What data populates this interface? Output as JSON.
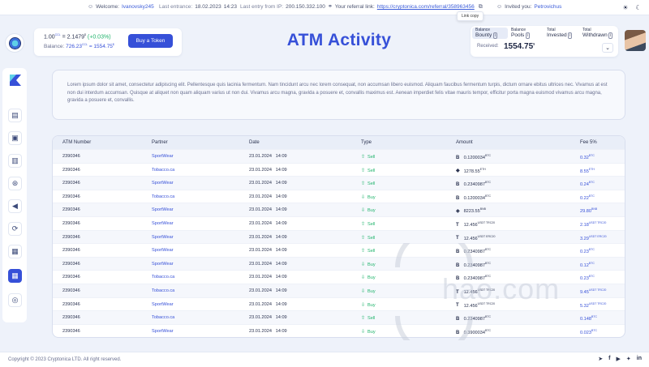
{
  "topbar": {
    "welcome_label": "Welcome:",
    "username": "Ivanovsky245",
    "last_entrance_label": "Last entrance:",
    "last_entrance_date": "18.02.2023",
    "last_entrance_time": "14:23",
    "last_ip_label": "Last entry from IP:",
    "last_ip": "200.150.332.100",
    "referral_label": "Your referral link:",
    "referral_link": "https://cryptonica.com/referral/358963456",
    "copy_tooltip": "Link copy",
    "invited_label": "Invited you:",
    "invited_by": "Petrovichus"
  },
  "rate": {
    "line1_prefix": "1.00",
    "line1_unit": "CCL",
    "line1_eq": " = 2.1479",
    "line1_usd": "$",
    "line1_change": " (+0.03%)",
    "balance_label": "Balance:",
    "balance_ccl": "726.23",
    "balance_unit": "CCL",
    "balance_usd": " = 1554.75",
    "balance_usd_sign": "$",
    "buy_button": "Buy a Token"
  },
  "page_title": "ATM Activity",
  "balance_panel": {
    "tabs": [
      {
        "top": "Balance",
        "bottom": "Bounty"
      },
      {
        "top": "Balance",
        "bottom": "Pools"
      },
      {
        "top": "Total",
        "bottom": "Invested"
      },
      {
        "top": "Total",
        "bottom": "Withdrawn"
      }
    ],
    "received_label": "Received:",
    "received_value": "1554.75",
    "received_sign": "$"
  },
  "description": "Lorem ipsum dolor sit amet, consectetur adipiscing elit. Pellentesque quis lacinia fermentum. Nam tincidunt arcu nec lorem consequat, non accumsan libero euismod. Aliquam faucibus fermentum turpis, dictum ornare ebitus ultrices nec. Vivamus at est non dui interdum accumsan. Quisque at aliquet non quam aliquam varius ut non dui. Vivamus arcu magna, gravida a posuere et, convallis maximus est. Aenean imperdiet felis vitae mauris tempor, efficitur porta magna euismod vivamus arcu magna, gravida a posuere et, convallis.",
  "table": {
    "headers": [
      "ATM Number",
      "Partner",
      "Date",
      "Type",
      "Amount",
      "Fee 5%"
    ],
    "rows": [
      {
        "atm": "2390346",
        "partner": "SportWear",
        "date": "23.01.2024",
        "time": "14:09",
        "type": "Sell",
        "dir": "up",
        "sym": "B",
        "amount": "0.1200034",
        "unit": "BTC",
        "fee": "0.32",
        "fee_unit": "BTC"
      },
      {
        "atm": "2390346",
        "partner": "Tobacco.ca",
        "date": "23.01.2024",
        "time": "14:09",
        "type": "Sell",
        "dir": "up",
        "sym": "◆",
        "amount": "1278.55",
        "unit": "ETH",
        "fee": "8.55",
        "fee_unit": "ETH"
      },
      {
        "atm": "2390346",
        "partner": "SportWear",
        "date": "23.01.2024",
        "time": "14:09",
        "type": "Sell",
        "dir": "up",
        "sym": "B",
        "amount": "0.2340987",
        "unit": "BTC",
        "fee": "0.24",
        "fee_unit": "BTC"
      },
      {
        "atm": "2390346",
        "partner": "Tobacco.ca",
        "date": "23.01.2024",
        "time": "14:09",
        "type": "Buy",
        "dir": "down",
        "sym": "B",
        "amount": "0.1200034",
        "unit": "BTC",
        "fee": "0.22",
        "fee_unit": "BTC"
      },
      {
        "atm": "2390346",
        "partner": "SportWear",
        "date": "23.01.2024",
        "time": "14:09",
        "type": "Buy",
        "dir": "down",
        "sym": "◈",
        "amount": "8223.55",
        "unit": "BNB",
        "fee": "29.80",
        "fee_unit": "BNB"
      },
      {
        "atm": "2390346",
        "partner": "SportWear",
        "date": "23.01.2024",
        "time": "14:09",
        "type": "Sell",
        "dir": "up",
        "sym": "T",
        "amount": "12.456",
        "unit": "USDT TRC20",
        "fee": "2.18",
        "fee_unit": "USDT TRC20"
      },
      {
        "atm": "2390346",
        "partner": "SportWear",
        "date": "23.01.2024",
        "time": "14:09",
        "type": "Sell",
        "dir": "up",
        "sym": "T",
        "amount": "12.456",
        "unit": "USDT ERC20",
        "fee": "3.29",
        "fee_unit": "USDT ERC20"
      },
      {
        "atm": "2390346",
        "partner": "SportWear",
        "date": "23.01.2024",
        "time": "14:09",
        "type": "Sell",
        "dir": "up",
        "sym": "B",
        "amount": "0.2340987",
        "unit": "BTC",
        "fee": "0.23",
        "fee_unit": "BTC"
      },
      {
        "atm": "2390346",
        "partner": "SportWear",
        "date": "23.01.2024",
        "time": "14:09",
        "type": "Buy",
        "dir": "down",
        "sym": "B",
        "amount": "0.2340987",
        "unit": "BTC",
        "fee": "0.12",
        "fee_unit": "BTC"
      },
      {
        "atm": "2390346",
        "partner": "Tobacco.ca",
        "date": "23.01.2024",
        "time": "14:09",
        "type": "Buy",
        "dir": "down",
        "sym": "B",
        "amount": "0.2340987",
        "unit": "BTC",
        "fee": "0.23",
        "fee_unit": "BTC"
      },
      {
        "atm": "2390346",
        "partner": "Tobacco.ca",
        "date": "23.01.2024",
        "time": "14:09",
        "type": "Buy",
        "dir": "down",
        "sym": "T",
        "amount": "12.456",
        "unit": "USDT TRC20",
        "fee": "9.45",
        "fee_unit": "USDT TRC20"
      },
      {
        "atm": "2390346",
        "partner": "SportWear",
        "date": "23.01.2024",
        "time": "14:09",
        "type": "Buy",
        "dir": "down",
        "sym": "T",
        "amount": "12.456",
        "unit": "USDT TRC20",
        "fee": "5.32",
        "fee_unit": "USDT TRC20"
      },
      {
        "atm": "2390346",
        "partner": "Tobacco.ca",
        "date": "23.01.2024",
        "time": "14:09",
        "type": "Sell",
        "dir": "up",
        "sym": "B",
        "amount": "0.2340987",
        "unit": "BTC",
        "fee": "0.148",
        "fee_unit": "BTC"
      },
      {
        "atm": "2390346",
        "partner": "SportWear",
        "date": "23.01.2024",
        "time": "14:09",
        "type": "Buy",
        "dir": "down",
        "sym": "B",
        "amount": "0.3900034",
        "unit": "BTC",
        "fee": "0.023",
        "fee_unit": "BTC"
      }
    ]
  },
  "watermark": "hao.com",
  "footer": {
    "copyright": "Copyright © 2023 Cryptonica LTD. All right reserved.",
    "social_icons": [
      "telegram-icon",
      "facebook-icon",
      "youtube-icon",
      "twitter-icon",
      "linkedin-icon"
    ]
  }
}
